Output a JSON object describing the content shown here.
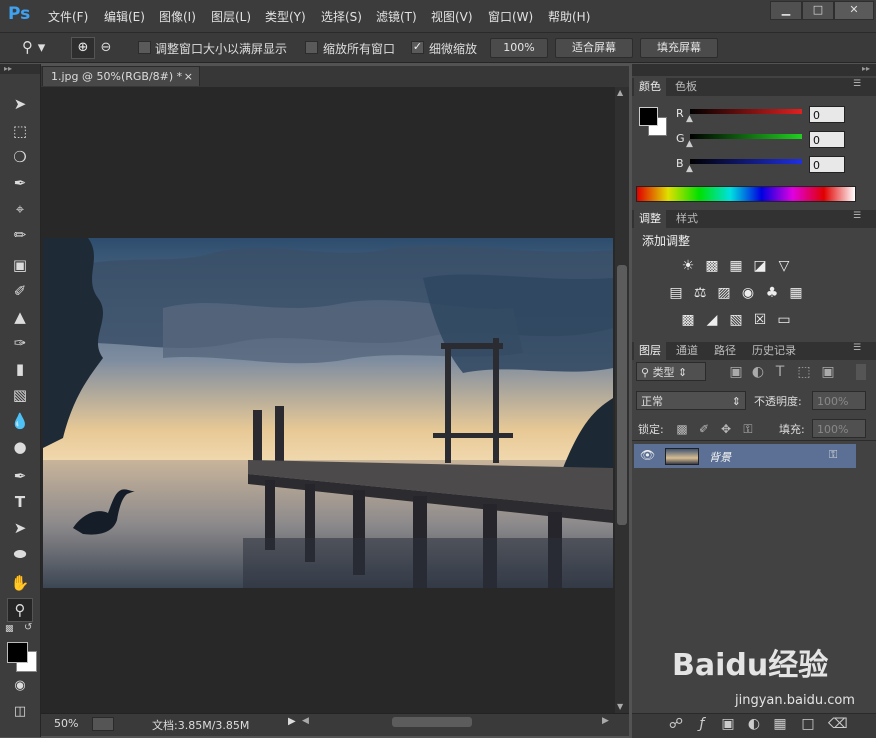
{
  "app": {
    "logo": "Ps"
  },
  "menu": [
    "文件(F)",
    "编辑(E)",
    "图像(I)",
    "图层(L)",
    "类型(Y)",
    "选择(S)",
    "滤镜(T)",
    "视图(V)",
    "窗口(W)",
    "帮助(H)"
  ],
  "window_controls": {
    "minimize": "▁",
    "maximize": "□",
    "close": "✕"
  },
  "options": {
    "resize_windows_label": "调整窗口大小以满屏显示",
    "resize_windows_checked": false,
    "zoom_all_label": "缩放所有窗口",
    "zoom_all_checked": false,
    "scrubby_label": "细微缩放",
    "scrubby_checked": true,
    "btn_100": "100%",
    "btn_fit": "适合屏幕",
    "btn_fill": "填充屏幕"
  },
  "document": {
    "tab_title": "1.jpg @ 50%(RGB/8#) *",
    "close": "×"
  },
  "status": {
    "zoom": "50%",
    "doc_info": "文档:3.85M/3.85M"
  },
  "color_panel": {
    "tabs": [
      "颜色",
      "色板"
    ],
    "channels": [
      {
        "label": "R",
        "value": "0",
        "color": "#e02020"
      },
      {
        "label": "G",
        "value": "0",
        "color": "#20d020"
      },
      {
        "label": "B",
        "value": "0",
        "color": "#2030e0"
      }
    ]
  },
  "adjust_panel": {
    "tabs": [
      "调整",
      "样式"
    ],
    "title": "添加调整"
  },
  "layers_panel": {
    "tabs": [
      "图层",
      "通道",
      "路径",
      "历史记录"
    ],
    "filter_kind": "类型",
    "blend_mode": "正常",
    "opacity_label": "不透明度:",
    "opacity_value": "100%",
    "lock_label": "锁定:",
    "fill_label": "填充:",
    "fill_value": "100%",
    "layers": [
      {
        "name": "背景",
        "visible": true,
        "locked": true
      }
    ]
  },
  "watermark": {
    "brand": "Baidu经验",
    "url": "jingyan.baidu.com"
  }
}
